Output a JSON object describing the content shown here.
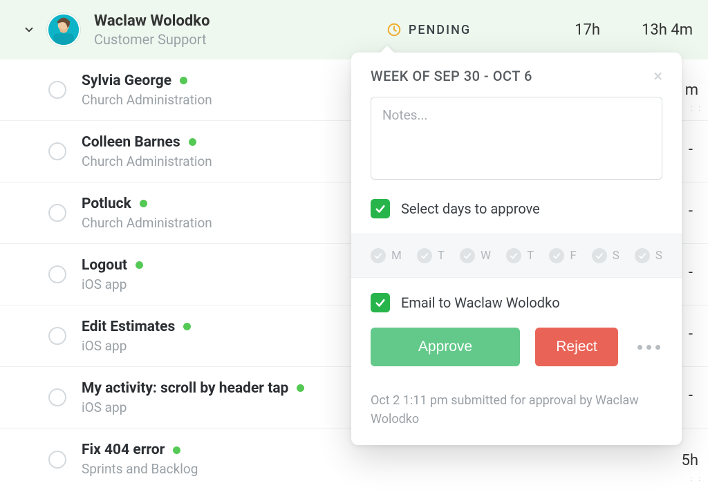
{
  "header": {
    "name": "Waclaw Wolodko",
    "role": "Customer Support",
    "status_label": "PENDING",
    "time1": "17h",
    "time2": "13h 4m"
  },
  "tasks": [
    {
      "title": "Sylvia George",
      "sub": "Church Administration"
    },
    {
      "title": "Colleen Barnes",
      "sub": "Church Administration"
    },
    {
      "title": "Potluck",
      "sub": "Church Administration"
    },
    {
      "title": "Logout",
      "sub": "iOS app"
    },
    {
      "title": "Edit Estimates",
      "sub": "iOS app"
    },
    {
      "title": "My activity: scroll by header tap",
      "sub": "iOS app"
    },
    {
      "title": "Fix 404 error",
      "sub": "Sprints and Backlog"
    }
  ],
  "right_col": {
    "partial_top_value": "m",
    "bottom_value": "5h"
  },
  "popover": {
    "title": "WEEK OF SEP 30 - OCT 6",
    "notes_placeholder": "Notes...",
    "select_days_label": "Select days to approve",
    "days": [
      "M",
      "T",
      "W",
      "T",
      "F",
      "S",
      "S"
    ],
    "email_label": "Email to Waclaw Wolodko",
    "approve_label": "Approve",
    "reject_label": "Reject",
    "footer": "Oct 2 1:11 pm submitted for approval by Waclaw Wolodko"
  }
}
